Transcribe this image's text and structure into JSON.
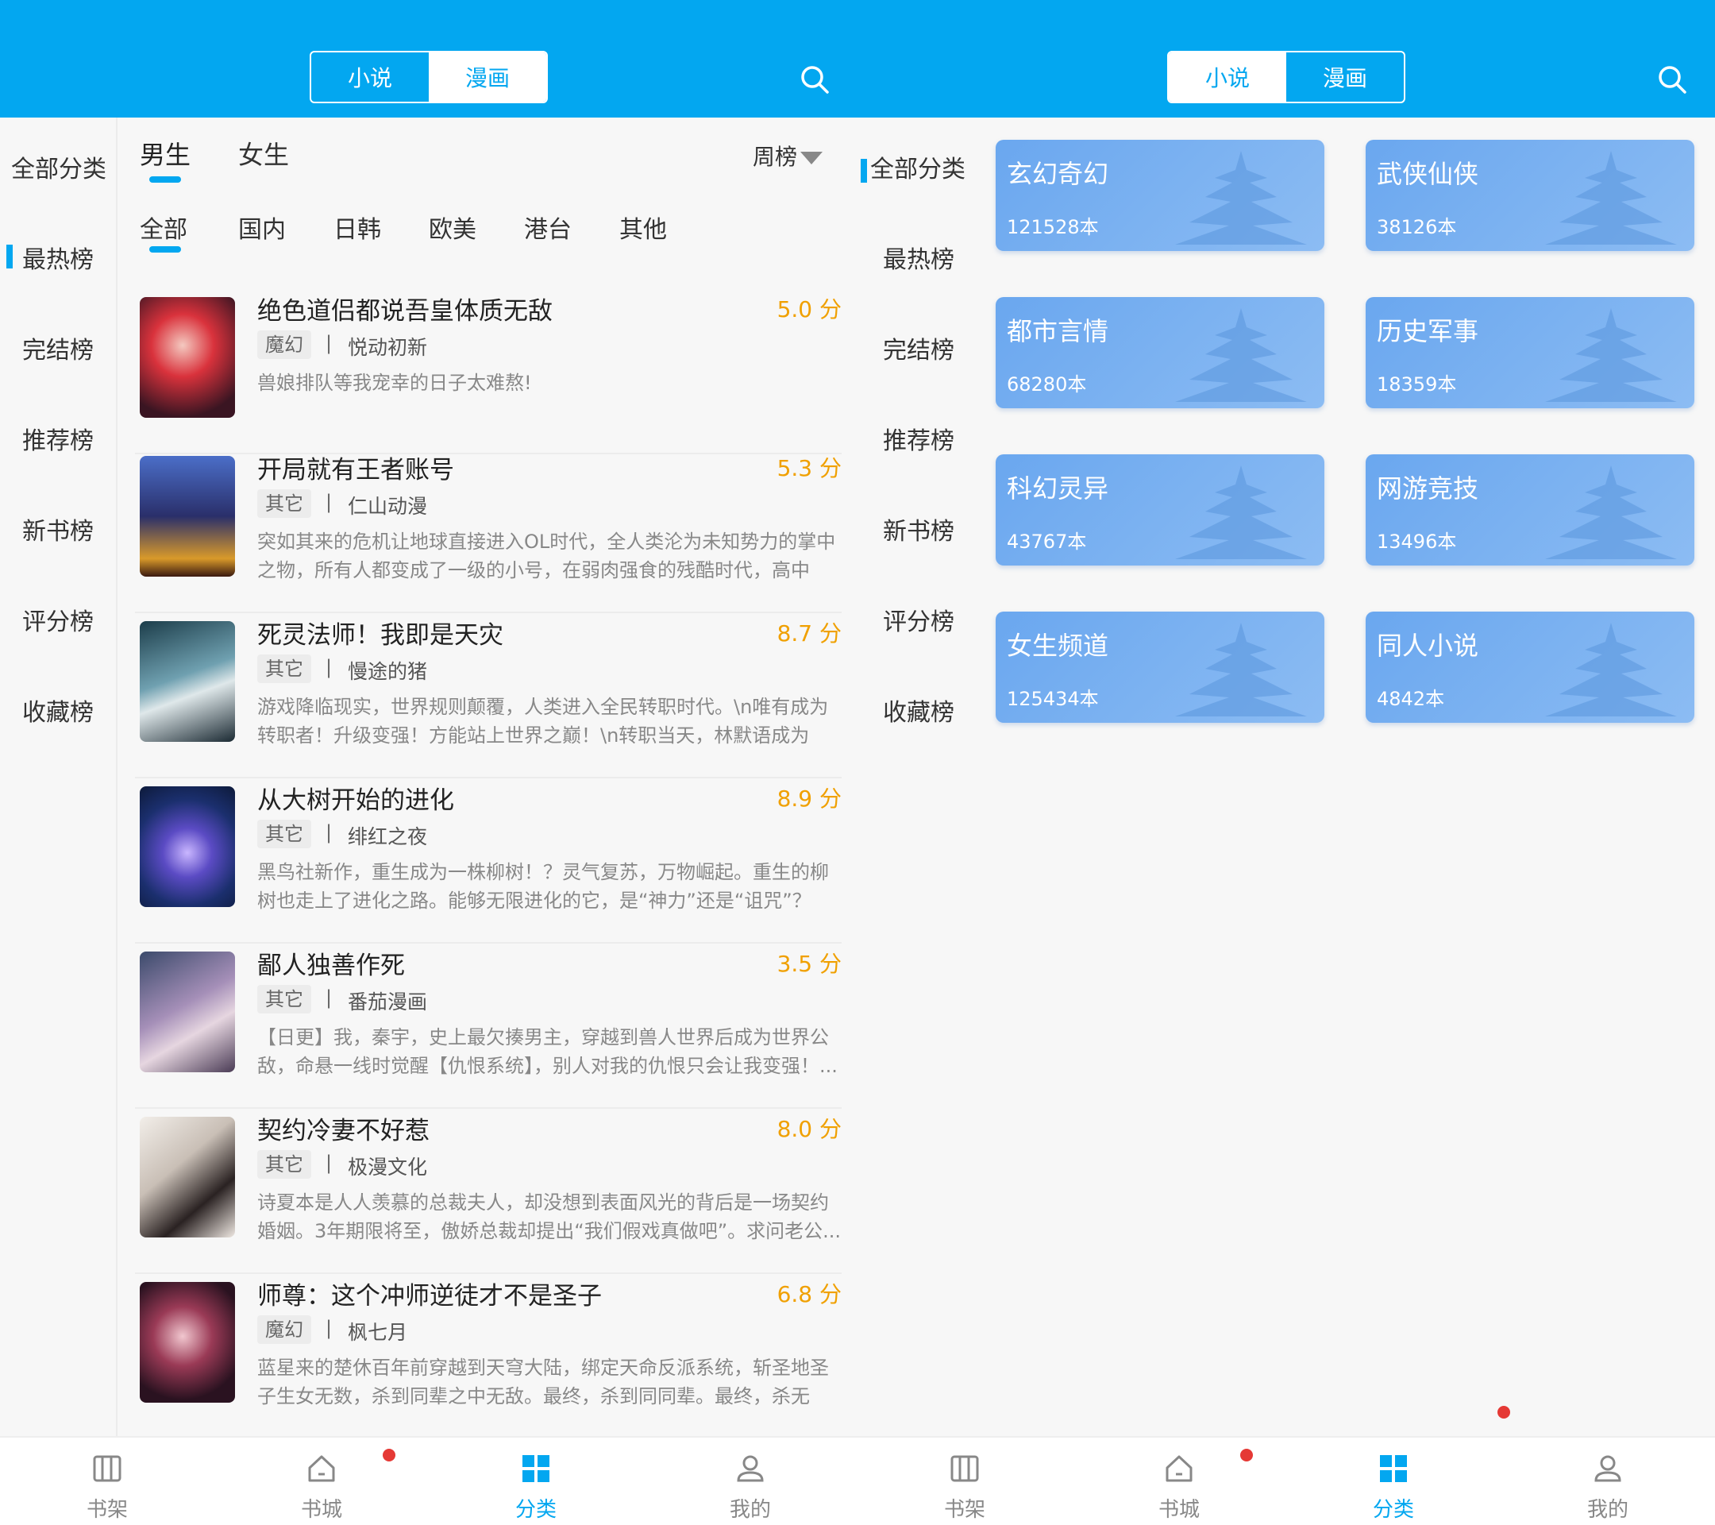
{
  "left": {
    "header": {
      "tabs": [
        "小说",
        "漫画"
      ],
      "active_tab": "漫画"
    },
    "side": {
      "heading": "全部分类",
      "items": [
        "最热榜",
        "完结榜",
        "推荐榜",
        "新书榜",
        "评分榜",
        "收藏榜"
      ],
      "active": "最热榜"
    },
    "gender_tabs": [
      "男生",
      "女生"
    ],
    "ranking_select": "周榜",
    "region_tabs": [
      "全部",
      "国内",
      "日韩",
      "欧美",
      "港台",
      "其他"
    ],
    "books": [
      {
        "title": "绝色道侣都说吾皇体质无敌",
        "score": "5.0 分",
        "tag": "魔幻",
        "author": "悦动初新",
        "desc": "兽娘排队等我宠幸的日子太难熬!"
      },
      {
        "title": "开局就有王者账号",
        "score": "5.3 分",
        "tag": "其它",
        "author": "仁山动漫",
        "desc": "突如其来的危机让地球直接进入OL时代，全人类沦为未知势力的掌中之物，所有人都变成了一级的小号，在弱肉强食的残酷时代，高中生..."
      },
      {
        "title": "死灵法师！我即是天灾",
        "score": "8.7 分",
        "tag": "其它",
        "author": "慢途的猪",
        "desc": "游戏降临现实，世界规则颠覆，人类进入全民转职时代。\\n唯有成为转职者！升级变强！方能站上世界之巅！\\n转职当天，林默语成为唯..."
      },
      {
        "title": "从大树开始的进化",
        "score": "8.9 分",
        "tag": "其它",
        "author": "绯红之夜",
        "desc": "黑鸟社新作，重生成为一株柳树！？灵气复苏，万物崛起。重生的柳树也走上了进化之路。能够无限进化的它，是“神力”还是“诅咒”？"
      },
      {
        "title": "鄙人独善作死",
        "score": "3.5 分",
        "tag": "其它",
        "author": "番茄漫画",
        "desc": "【日更】我，秦宇，史上最欠揍男主，穿越到兽人世界后成为世界公敌，命悬一线时觉醒【仇恨系统】，别人对我的仇恨只会让我变强！..."
      },
      {
        "title": "契约冷妻不好惹",
        "score": "8.0 分",
        "tag": "其它",
        "author": "极漫文化",
        "desc": "诗夏本是人人羡慕的总裁夫人，却没想到表面风光的背后是一场契约婚姻。3年期限将至，傲娇总裁却提出“我们假戏真做吧”。求问老公..."
      },
      {
        "title": "师尊：这个冲师逆徒才不是圣子",
        "score": "6.8 分",
        "tag": "魔幻",
        "author": "枫七月",
        "desc": "蓝星来的楚休百年前穿越到天穹大陆，绑定天命反派系统，斩圣地圣子生女无数，杀到同辈之中无敌。最终，杀到同同辈。最终，杀无葯..."
      }
    ],
    "bottom_tabs": [
      "书架",
      "书城",
      "分类",
      "我的"
    ],
    "bottom_active": "分类"
  },
  "right": {
    "header": {
      "tabs": [
        "小说",
        "漫画"
      ],
      "active_tab": "小说"
    },
    "side": {
      "heading": "全部分类",
      "items": [
        "最热榜",
        "完结榜",
        "推荐榜",
        "新书榜",
        "评分榜",
        "收藏榜"
      ]
    },
    "categories": [
      {
        "name": "玄幻奇幻",
        "count": "121528本"
      },
      {
        "name": "武侠仙侠",
        "count": "38126本"
      },
      {
        "name": "都市言情",
        "count": "68280本"
      },
      {
        "name": "历史军事",
        "count": "18359本"
      },
      {
        "name": "科幻灵异",
        "count": "43767本"
      },
      {
        "name": "网游竞技",
        "count": "13496本"
      },
      {
        "name": "女生频道",
        "count": "125434本"
      },
      {
        "name": "同人小说",
        "count": "4842本"
      }
    ],
    "bottom_tabs": [
      "书架",
      "书城",
      "分类",
      "我的"
    ],
    "bottom_active": "分类"
  },
  "colors": {
    "accent": "#03a7f0",
    "score": "#f0a000",
    "card": "#6aa7ef",
    "badge": "#e53935"
  },
  "icons": [
    "search-icon",
    "bookshelf-icon",
    "store-icon",
    "category-icon",
    "profile-icon",
    "dropdown-triangle-icon"
  ]
}
